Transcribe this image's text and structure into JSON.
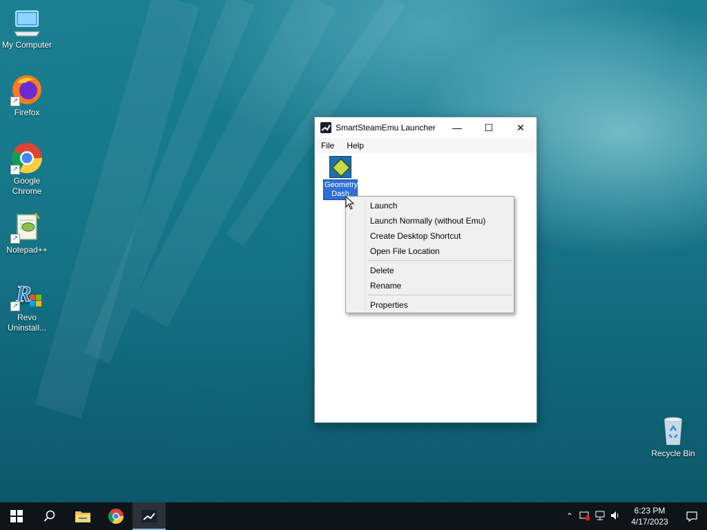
{
  "desktop": {
    "icons": [
      {
        "label": "My Computer",
        "icon": "monitor-icon"
      },
      {
        "label": "Firefox",
        "icon": "firefox-icon"
      },
      {
        "label": "Google Chrome",
        "icon": "chrome-icon"
      },
      {
        "label": "Notepad++",
        "icon": "notepadpp-icon"
      },
      {
        "label": "Revo Uninstall...",
        "icon": "revo-icon"
      },
      {
        "label": "Recycle Bin",
        "icon": "recycle-bin-icon"
      }
    ]
  },
  "window": {
    "title": "SmartSteamEmu Launcher",
    "buttons": {
      "minimize": "—",
      "maximize": "☐",
      "close": "✕"
    },
    "menu": [
      "File",
      "Help"
    ],
    "game": {
      "label_line1": "Geometry",
      "label_line2": "Dash"
    }
  },
  "context_menu": {
    "items": [
      {
        "label": "Launch"
      },
      {
        "label": "Launch Normally (without Emu)"
      },
      {
        "label": "Create Desktop Shortcut"
      },
      {
        "label": "Open File Location"
      },
      {
        "separator": true
      },
      {
        "label": "Delete"
      },
      {
        "label": "Rename"
      },
      {
        "separator": true
      },
      {
        "label": "Properties"
      }
    ]
  },
  "taskbar": {
    "clock_time": "6:23 PM",
    "clock_date": "4/17/2023"
  },
  "colors": {
    "accent": "#2f6fd6",
    "taskbar": "#0e1418"
  }
}
